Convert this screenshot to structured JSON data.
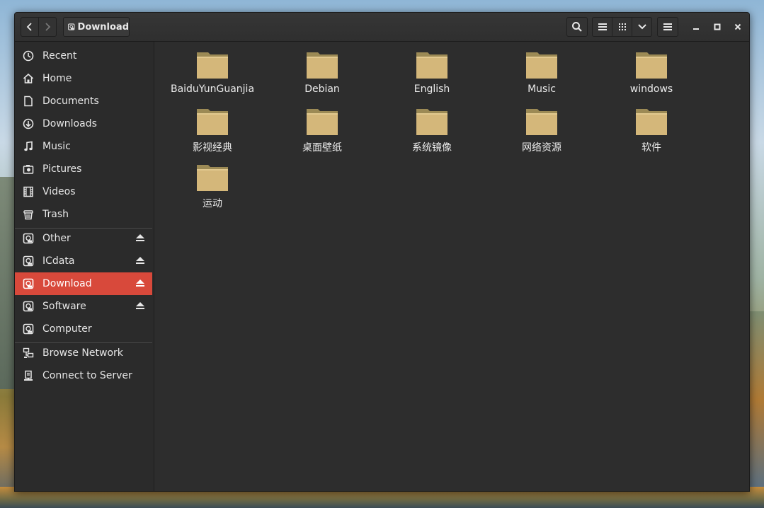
{
  "window": {
    "title": "Download"
  },
  "headerbar": {
    "path_label": "Download",
    "back_icon": "chevron-left-icon",
    "forward_icon": "chevron-right-icon",
    "search_icon": "search-icon",
    "list_view_icon": "list-view-icon",
    "grid_view_icon": "grid-view-icon",
    "view_menu_icon": "chevron-down-icon",
    "app_menu_icon": "hamburger-menu-icon"
  },
  "sidebar": {
    "places": [
      {
        "label": "Recent",
        "icon": "clock-icon"
      },
      {
        "label": "Home",
        "icon": "home-icon"
      },
      {
        "label": "Documents",
        "icon": "document-icon"
      },
      {
        "label": "Downloads",
        "icon": "download-icon"
      },
      {
        "label": "Music",
        "icon": "music-icon"
      },
      {
        "label": "Pictures",
        "icon": "camera-icon"
      },
      {
        "label": "Videos",
        "icon": "film-icon"
      },
      {
        "label": "Trash",
        "icon": "trash-icon"
      }
    ],
    "devices": [
      {
        "label": "Other",
        "icon": "drive-icon",
        "eject": true
      },
      {
        "label": "ICdata",
        "icon": "drive-icon",
        "eject": true
      },
      {
        "label": "Download",
        "icon": "drive-icon",
        "eject": true,
        "active": true
      },
      {
        "label": "Software",
        "icon": "drive-icon",
        "eject": true
      },
      {
        "label": "Computer",
        "icon": "drive-icon",
        "eject": false
      }
    ],
    "network": [
      {
        "label": "Browse Network",
        "icon": "network-icon"
      },
      {
        "label": "Connect to Server",
        "icon": "server-icon"
      }
    ]
  },
  "files": [
    {
      "name": "BaiduYunGuanjia"
    },
    {
      "name": "Debian"
    },
    {
      "name": "English"
    },
    {
      "name": "Music"
    },
    {
      "name": "windows"
    },
    {
      "name": "影视经典"
    },
    {
      "name": "桌面壁纸"
    },
    {
      "name": "系统镜像"
    },
    {
      "name": "网络资源"
    },
    {
      "name": "软件"
    },
    {
      "name": "运动"
    }
  ],
  "colors": {
    "accent": "#d8493b",
    "folder": "#d4b77a",
    "folder_tab": "#9c8a55"
  }
}
